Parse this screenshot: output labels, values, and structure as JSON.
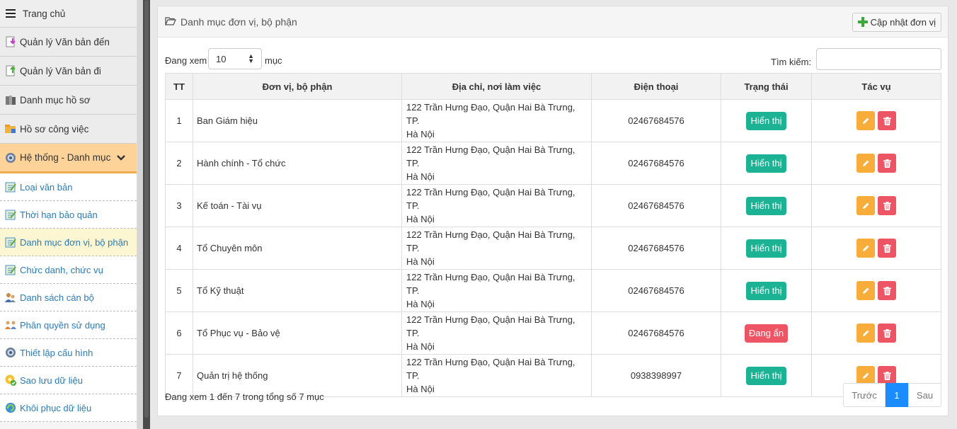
{
  "sidebar": {
    "home": "Trang chủ",
    "items": [
      {
        "label": "Quản lý Văn bản đến",
        "icon": "incoming-doc-icon"
      },
      {
        "label": "Quản lý Văn bản đi",
        "icon": "outgoing-doc-icon"
      },
      {
        "label": "Danh mục hồ sơ",
        "icon": "records-icon"
      },
      {
        "label": "Hồ sơ công việc",
        "icon": "work-folder-icon"
      },
      {
        "label": "Hệ thống - Danh mục",
        "icon": "system-gear-icon"
      }
    ],
    "subitems": [
      {
        "label": "Loại văn bản"
      },
      {
        "label": "Thời hạn bảo quản"
      },
      {
        "label": "Danh mục đơn vị, bộ phận"
      },
      {
        "label": "Chức danh, chức vụ"
      },
      {
        "label": "Danh sách cán bộ"
      },
      {
        "label": "Phân quyền sử dụng"
      },
      {
        "label": "Thiết lập cấu hình"
      },
      {
        "label": "Sao lưu dữ liệu"
      },
      {
        "label": "Khôi phục dữ liệu"
      }
    ]
  },
  "panel": {
    "title": "Danh mục đơn vị, bộ phận",
    "update_button": "Cập nhật đơn vị"
  },
  "controls": {
    "length_prefix": "Đang xem",
    "length_value": "10",
    "length_suffix": "mục",
    "search_label": "Tìm kiếm:",
    "search_value": ""
  },
  "table": {
    "headers": [
      "TT",
      "Đơn vị, bộ phận",
      "Địa chỉ, nơi làm việc",
      "Điện thoại",
      "Trạng thái",
      "Tác vụ"
    ],
    "rows": [
      {
        "tt": "1",
        "name": "Ban Giám hiệu",
        "addr1": "122 Trần Hưng Đạo, Quận Hai Bà Trưng, TP.",
        "addr2": "Hà Nội",
        "phone": "02467684576",
        "status": "Hiển thị"
      },
      {
        "tt": "2",
        "name": "Hành chính - Tổ chức",
        "addr1": "122 Trần Hưng Đạo, Quận Hai Bà Trưng, TP.",
        "addr2": "Hà Nội",
        "phone": "02467684576",
        "status": "Hiển thị"
      },
      {
        "tt": "3",
        "name": "Kế toán - Tài vụ",
        "addr1": "122 Trần Hưng Đạo, Quận Hai Bà Trưng, TP.",
        "addr2": "Hà Nội",
        "phone": "02467684576",
        "status": "Hiển thị"
      },
      {
        "tt": "4",
        "name": "Tổ Chuyên môn",
        "addr1": "122 Trần Hưng Đạo, Quận Hai Bà Trưng, TP.",
        "addr2": "Hà Nội",
        "phone": "02467684576",
        "status": "Hiển thị"
      },
      {
        "tt": "5",
        "name": "Tổ Kỹ thuật",
        "addr1": "122 Trần Hưng Đạo, Quận Hai Bà Trưng, TP.",
        "addr2": "Hà Nội",
        "phone": "02467684576",
        "status": "Hiển thị"
      },
      {
        "tt": "6",
        "name": "Tổ Phục vụ - Bảo vệ",
        "addr1": "122 Trần Hưng Đạo, Quận Hai Bà Trưng, TP.",
        "addr2": "Hà Nội",
        "phone": "02467684576",
        "status": "Đang ẩn"
      },
      {
        "tt": "7",
        "name": "Quản trị hệ thống",
        "addr1": "122 Trần Hưng Đạo, Quận Hai Bà Trưng, TP.",
        "addr2": "Hà Nội",
        "phone": "0938398997",
        "status": "Hiển thị"
      }
    ]
  },
  "footer": {
    "info": "Đang xem 1 đến 7 trong tổng số 7 mục",
    "prev": "Trước",
    "page": "1",
    "next": "Sau"
  },
  "colors": {
    "active_menu_bg": "#fdd39a",
    "status_shown": "#1bb394",
    "status_hidden": "#ed5565",
    "edit_button": "#f8ac3a",
    "delete_button": "#ed5565",
    "pager_active": "#1a8cff"
  }
}
